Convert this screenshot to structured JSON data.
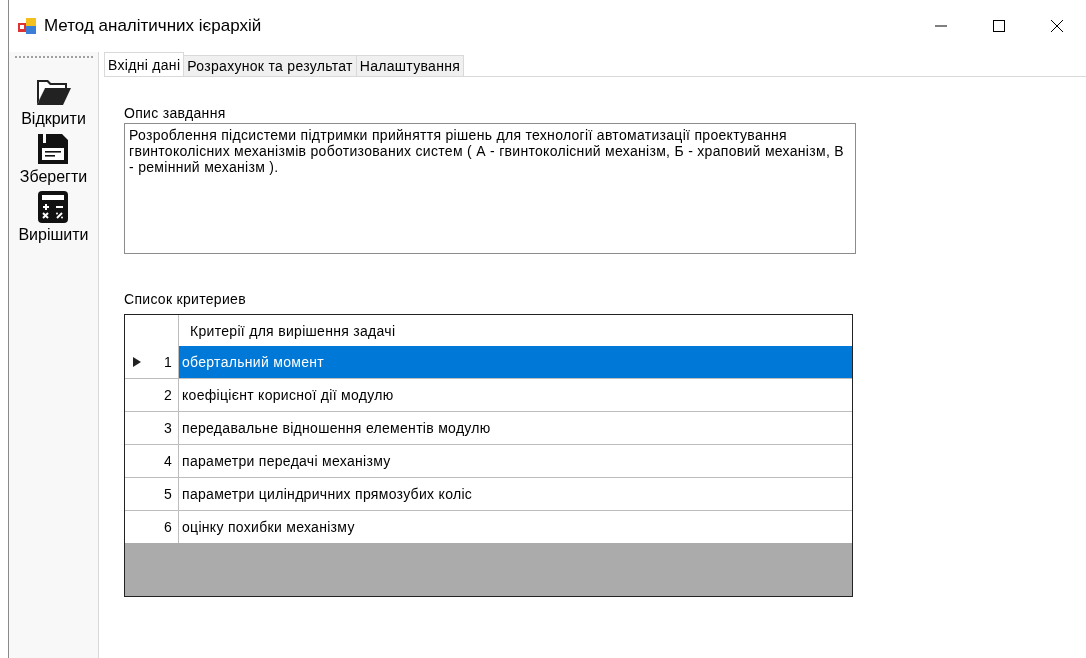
{
  "window": {
    "title": "Метод аналітичних ієрархій"
  },
  "toolbar": {
    "items": [
      {
        "kind": "open",
        "label": "Відкрити"
      },
      {
        "kind": "save",
        "label": "Зберегти"
      },
      {
        "kind": "solve",
        "label": "Вирішити"
      }
    ]
  },
  "tabs": [
    {
      "label": "Вхідні дані",
      "selected": true
    },
    {
      "label": "Розрахунок та результат",
      "selected": false
    },
    {
      "label": "Налаштування",
      "selected": false
    }
  ],
  "description": {
    "label": "Опис завдання",
    "value": "Розроблення підсистеми підтримки прийняття рішень для технології автоматизації проектування гвинтоколісних механізмів роботизованих систем ( А - гвинтоколісний механізм, Б - храповий механізм, В - ремінний механізм )."
  },
  "criteria": {
    "label": "Список критериев",
    "columns": [
      "Критерії для вирішення задачі"
    ],
    "rows": [
      {
        "number": "1",
        "text": "обертальний момент",
        "selected": true
      },
      {
        "number": "2",
        "text": "коефіцієнт корисної дії модулю",
        "selected": false
      },
      {
        "number": "3",
        "text": "передавальне відношення елементів модулю",
        "selected": false
      },
      {
        "number": "4",
        "text": "параметри передачі механізму",
        "selected": false
      },
      {
        "number": "5",
        "text": "параметри циліндричних прямозубих коліс",
        "selected": false
      },
      {
        "number": "6",
        "text": "оцінку похибки механізму",
        "selected": false
      }
    ]
  }
}
